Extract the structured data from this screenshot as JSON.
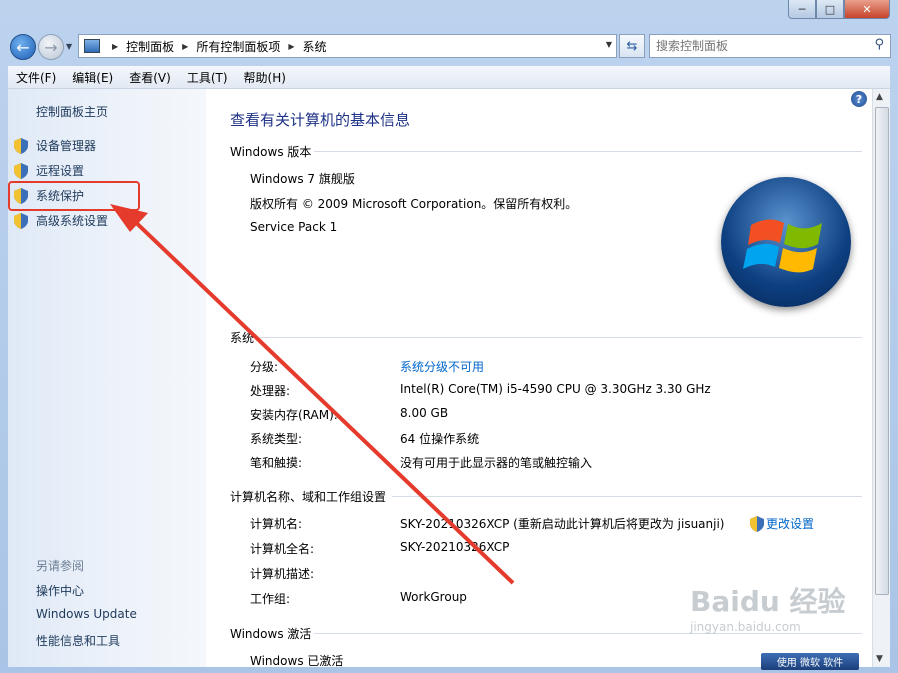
{
  "window": {
    "min_label": "─",
    "max_label": "□",
    "close_label": "✕"
  },
  "nav": {
    "breadcrumbs": [
      "控制面板",
      "所有控制面板项",
      "系统"
    ],
    "search_placeholder": "搜索控制面板"
  },
  "menu": [
    "文件(F)",
    "编辑(E)",
    "查看(V)",
    "工具(T)",
    "帮助(H)"
  ],
  "sidebar": {
    "home": "控制面板主页",
    "items": [
      "设备管理器",
      "远程设置",
      "系统保护",
      "高级系统设置"
    ],
    "see_also": "另请参阅",
    "links": [
      "操作中心",
      "Windows Update",
      "性能信息和工具"
    ]
  },
  "main": {
    "title": "查看有关计算机的基本信息",
    "edition": {
      "header": "Windows 版本",
      "name": "Windows 7 旗舰版",
      "copyright": "版权所有 © 2009 Microsoft Corporation。保留所有权利。",
      "sp": "Service Pack 1"
    },
    "system": {
      "header": "系统",
      "rows": [
        {
          "label": "分级:",
          "value": "系统分级不可用"
        },
        {
          "label": "处理器:",
          "value": "Intel(R) Core(TM) i5-4590 CPU @ 3.30GHz   3.30 GHz"
        },
        {
          "label": "安装内存(RAM):",
          "value": "8.00 GB"
        },
        {
          "label": "系统类型:",
          "value": "64 位操作系统"
        },
        {
          "label": "笔和触摸:",
          "value": "没有可用于此显示器的笔或触控输入"
        }
      ]
    },
    "computer": {
      "header": "计算机名称、域和工作组设置",
      "change": "更改设置",
      "rows": [
        {
          "label": "计算机名:",
          "value": "SKY-20210326XCP (重新启动此计算机后将更改为 jisuanji)"
        },
        {
          "label": "计算机全名:",
          "value": "SKY-20210326XCP"
        },
        {
          "label": "计算机描述:",
          "value": ""
        },
        {
          "label": "工作组:",
          "value": "WorkGroup"
        }
      ]
    },
    "activation": {
      "header": "Windows 激活",
      "status": "Windows 已激活"
    }
  },
  "watermark": {
    "brand": "Baidu 经验",
    "url": "jingyan.baidu.com"
  },
  "badge": "使用 微软 软件",
  "colors": {
    "annotation": "#e53b2c",
    "link": "#0066cc",
    "title": "#1e3287"
  }
}
